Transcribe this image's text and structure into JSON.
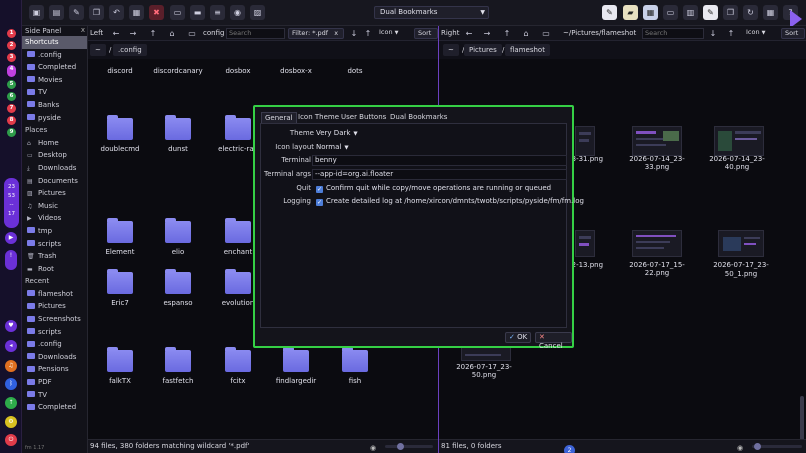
{
  "system_bar": {
    "workspaces": [
      {
        "label": "1",
        "color": "#e23b4a"
      },
      {
        "label": "2",
        "color": "#e23b4a"
      },
      {
        "label": "3",
        "color": "#e23b4a"
      },
      {
        "label": "4",
        "color": "#c040e0"
      },
      {
        "label": "5",
        "color": "#2e9c4a"
      },
      {
        "label": "6",
        "color": "#2e9c4a"
      },
      {
        "label": "7",
        "color": "#e23b4a"
      },
      {
        "label": "8",
        "color": "#e23b4a"
      },
      {
        "label": "9",
        "color": "#2e9c4a"
      }
    ],
    "clock": {
      "hour": "23",
      "minute": "53",
      "dash": "--",
      "day": "17"
    },
    "icons": [
      "video-icon",
      "bell-icon",
      "power-icon",
      "volume-icon",
      "headset-icon",
      "bluetooth-icon",
      "update-icon",
      "settings-icon",
      "shutdown-icon"
    ]
  },
  "toolbar": {
    "bookmark_select": "Dual Bookmarks"
  },
  "side_panel": {
    "title": "Side Panel",
    "close": "x",
    "shortcuts_label": "Shortcuts",
    "shortcuts": [
      ".config",
      "Completed",
      "Movies",
      "TV",
      "Banks",
      "pyside"
    ],
    "places_label": "Places",
    "places": [
      "Home",
      "Desktop",
      "Downloads",
      "Documents",
      "Pictures",
      "Music",
      "Videos",
      "tmp",
      "scripts",
      "Trash",
      "Root"
    ],
    "recent_label": "Recent",
    "recent": [
      "flameshot",
      "Pictures",
      "Screenshots",
      "scripts",
      ".config",
      "Downloads",
      "Pensions",
      "PDF",
      "TV",
      "Completed"
    ],
    "footer": "fm 1.17"
  },
  "left_pane": {
    "label": "Left",
    "path": "config",
    "search_placeholder": "Search",
    "filter": "Filter: *.pdf",
    "filter_clear": "x",
    "view": "Icon",
    "sort": "Sort",
    "crumbs": [
      "~",
      "/",
      ".config"
    ],
    "files": [
      "discord",
      "discordcanary",
      "dosbox",
      "dosbox-x",
      "dots",
      "doublecmd",
      "dunst",
      "electric-ray",
      "Element",
      "elio",
      "enchant",
      "Eric7",
      "espanso",
      "evolution",
      "falkTX",
      "fastfetch",
      "fcitx",
      "findlargedir",
      "fish"
    ],
    "status": "94 files, 380 folders matching wildcard '*.pdf'"
  },
  "right_pane": {
    "label": "Right",
    "path": "~/Pictures/flameshot",
    "search_placeholder": "Search",
    "view": "Icon",
    "sort": "Sort",
    "crumbs": [
      "~",
      "/",
      "Pictures",
      "/",
      "flameshot"
    ],
    "files": [
      "...3-31.png",
      "2026-07-14_23-33.png",
      "2026-07-14_23-40.png",
      "...2-13.png",
      "2026-07-17_15-22.png",
      "2026-07-17_23-50_1.png",
      "2026-07-17_23-50.png"
    ],
    "status": "81 files, 0 folders",
    "bottom_badge": "2"
  },
  "dialog": {
    "tabs": [
      "General",
      "Icon Theme",
      "User Buttons",
      "Dual Bookmarks"
    ],
    "fields": {
      "theme_label": "Theme",
      "theme_value": "Very Dark",
      "icon_layout_label": "Icon layout",
      "icon_layout_value": "Normal",
      "terminal_label": "Terminal",
      "terminal_value": "benny",
      "terminal_args_label": "Terminal args",
      "terminal_args_value": "--app-id=org.ai.floater",
      "quit_label": "Quit",
      "quit_text": "Confirm quit while copy/move operations are running or queued",
      "logging_label": "Logging",
      "logging_text": "Create detailed log at /home/xircon/dmnts/twotb/scripts/pyside/fm/fm.log"
    },
    "ok_label": "OK",
    "cancel_label": "Cancel"
  },
  "colors": {
    "accent": "#6b30d8",
    "dialog_border": "#35d045",
    "folder": "#7b7be8"
  }
}
